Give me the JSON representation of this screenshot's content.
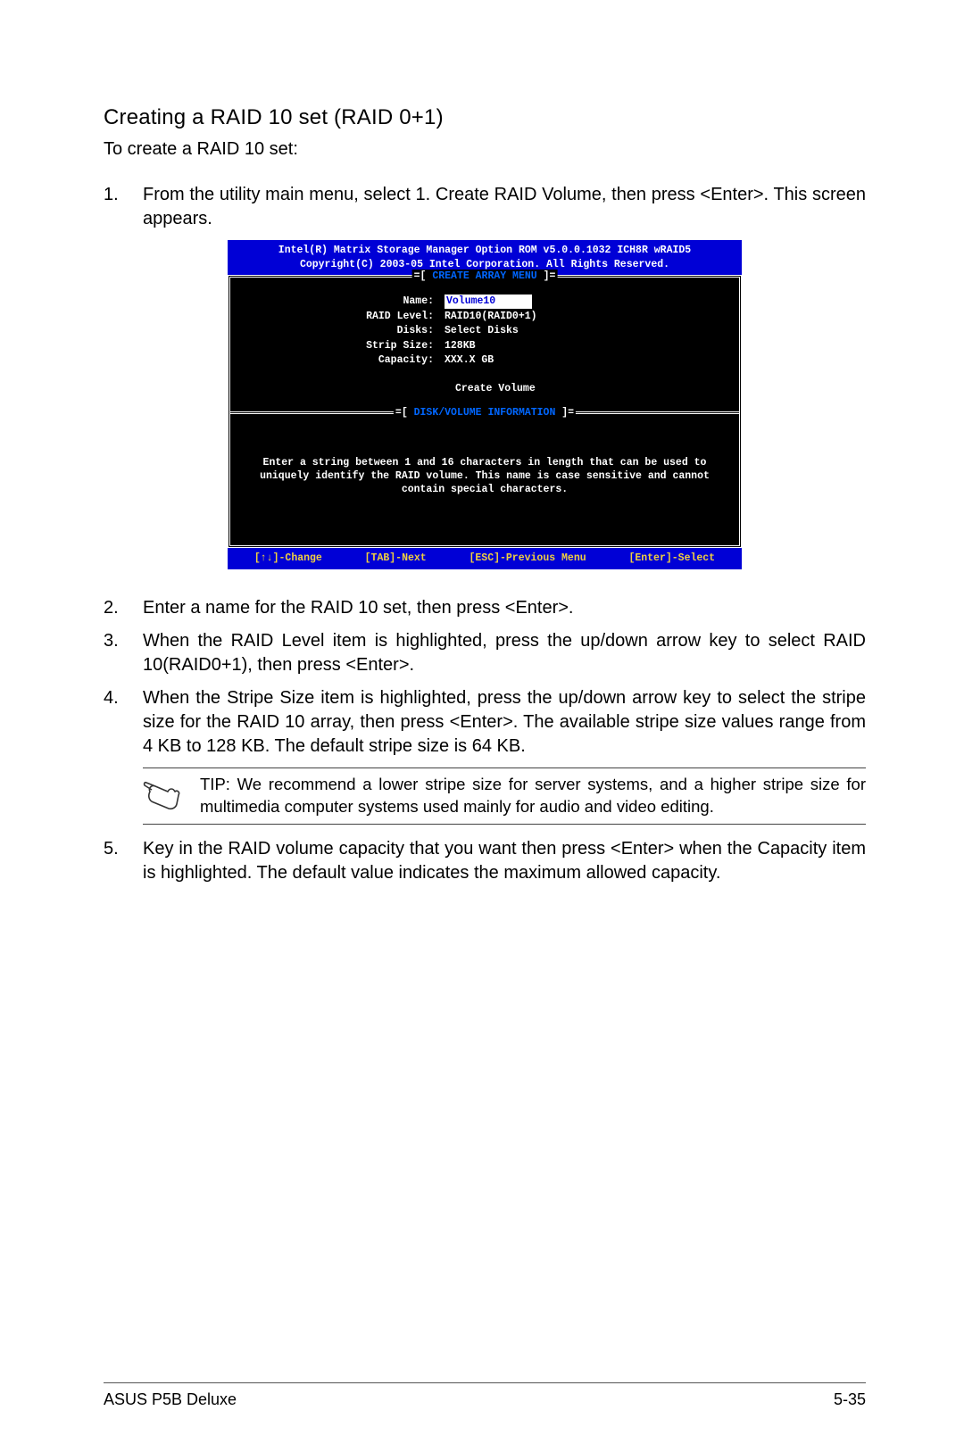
{
  "section_title": "Creating a RAID 10 set (RAID 0+1)",
  "intro": "To create a RAID 10 set:",
  "steps": {
    "s1": {
      "num": "1.",
      "text": "From the utility main menu, select 1. Create RAID Volume, then press <Enter>. This screen appears."
    },
    "s2": {
      "num": "2.",
      "text": "Enter a name for the RAID 10 set, then press <Enter>."
    },
    "s3": {
      "num": "3.",
      "text": "When the RAID Level item is highlighted, press the up/down arrow key to select RAID 10(RAID0+1), then press <Enter>."
    },
    "s4": {
      "num": "4.",
      "text": "When the Stripe Size item is highlighted, press the up/down arrow key to select the stripe size for the RAID 10 array, then press <Enter>. The available stripe size values range from 4 KB to 128 KB. The default stripe size is 64 KB."
    },
    "s5": {
      "num": "5.",
      "text": "Key in the RAID volume capacity that you want then press <Enter> when the Capacity item is highlighted. The default value indicates the maximum allowed capacity."
    }
  },
  "bios": {
    "header_l1": "Intel(R) Matrix Storage Manager Option ROM v5.0.0.1032 ICH8R wRAID5",
    "header_l2": "Copyright(C) 2003-05 Intel Corporation. All Rights Reserved.",
    "menu_title": "CREATE ARRAY MENU",
    "fields": {
      "name_label": "Name:",
      "name_value": "Volume10",
      "raid_label": "RAID Level:",
      "raid_value": "RAID10(RAID0+1)",
      "disks_label": "Disks:",
      "disks_value": "Select Disks",
      "strip_label": "Strip Size:",
      "strip_value": "128KB",
      "cap_label": "Capacity:",
      "cap_value": "XXX.X GB"
    },
    "create_volume": "Create Volume",
    "info_title": "DISK/VOLUME INFORMATION",
    "info_text": "Enter a string between 1 and 16 characters in length that can be used to uniquely identify the RAID volume. This name is case sensitive and cannot contain special characters.",
    "footer": {
      "k1": "[↑↓]-Change",
      "k2": "[TAB]-Next",
      "k3": "[ESC]-Previous Menu",
      "k4": "[Enter]-Select"
    }
  },
  "tip": "TIP: We recommend a lower stripe size for server systems, and a higher stripe size for multimedia computer systems used mainly for audio and video editing.",
  "footer": {
    "left": "ASUS P5B Deluxe",
    "right": "5-35"
  }
}
